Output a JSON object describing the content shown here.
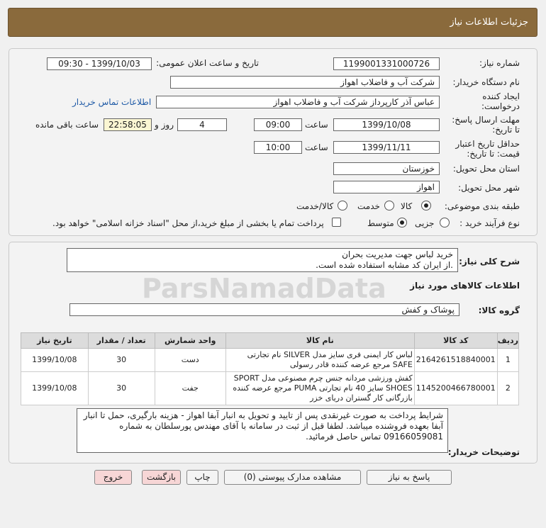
{
  "header": {
    "title": "جزئیات اطلاعات نیاز"
  },
  "form": {
    "need_number_label": "شماره نیاز:",
    "need_number": "1199001331000726",
    "announce_label": "تاریخ و ساعت اعلان عمومی:",
    "announce_value": "1399/10/03 - 09:30",
    "buyer_org_label": "نام دستگاه خریدار:",
    "buyer_org": "شرکت آب و فاضلاب اهواز",
    "creator_label": "ایجاد کننده درخواست:",
    "creator": "عباس آذر کارپرداز شرکت آب و فاضلاب اهواز",
    "contact_link": "اطلاعات تماس خریدار",
    "deadline_label": "مهلت ارسال پاسخ: تا تاریخ:",
    "deadline_date": "1399/10/08",
    "time_label": "ساعت",
    "deadline_time": "09:00",
    "days_value": "4",
    "days_label": "روز و",
    "remaining_time": "22:58:05",
    "remaining_label": "ساعت باقی مانده",
    "validity_label": "حداقل تاریخ اعتبار قیمت: تا تاریخ:",
    "validity_date": "1399/11/11",
    "validity_time": "10:00",
    "province_label": "استان محل تحویل:",
    "province": "خوزستان",
    "city_label": "شهر محل تحویل:",
    "city": "اهواز",
    "category_label": "طبقه بندی موضوعی:",
    "category_options": [
      "کالا",
      "خدمت",
      "کالا/خدمت"
    ],
    "process_label": "نوع فرآیند خرید :",
    "process_options": [
      "جزیی",
      "متوسط"
    ],
    "payment_note": "پرداخت تمام یا بخشی از مبلغ خرید،از محل \"اسناد خزانه اسلامی\" خواهد بود."
  },
  "summary": {
    "label": "شرح کلی نیاز:",
    "line1": "خرید لباس جهت مدیریت بحران",
    "line2": ".از ایران کد مشابه استفاده شده است."
  },
  "goods": {
    "section_title": "اطلاعات کالاهای مورد نیاز",
    "group_label": "گروه کالا:",
    "group_value": "پوشاک و کفش",
    "columns": [
      "ردیف",
      "کد کالا",
      "نام کالا",
      "واحد شمارش",
      "تعداد / مقدار",
      "تاریخ نیاز"
    ],
    "rows": [
      {
        "idx": "1",
        "code": "2164261518840001",
        "name": "لباس کار ایمنی فری سایز مدل SILVER نام تجارتی SAFE مرجع عرضه کننده قادر رسولی",
        "unit": "دست",
        "qty": "30",
        "date": "1399/10/08"
      },
      {
        "idx": "2",
        "code": "1145200466780001",
        "name": "کفش ورزشی مردانه جنس چرم مصنوعی مدل SPORT SHOES سایز 40 نام تجارتی PUMA مرجع عرضه کننده بازرگانی کار گستران دریای خزر",
        "unit": "جفت",
        "qty": "30",
        "date": "1399/10/08"
      }
    ]
  },
  "buyer_notes": {
    "label": "توضیحات خریدار:",
    "text": "شرایط پرداخت به صورت غیرنقدی  پس از تایید  و تحویل به انبار آبفا اهواز - هزینه بارگیری، حمل تا انبار آبفا بعهده فروشنده میباشد. لطفا قبل از ثبت در سامانه با آقای مهندس پورسلطان به شماره 09166059081  تماس حاصل فرمائید."
  },
  "buttons": {
    "reply": "پاسخ به نیاز",
    "docs": "مشاهده مدارک پیوستی (0)",
    "print": "چاپ",
    "back": "بازگشت",
    "exit": "خروج"
  },
  "watermark": "ParsNamadData"
}
